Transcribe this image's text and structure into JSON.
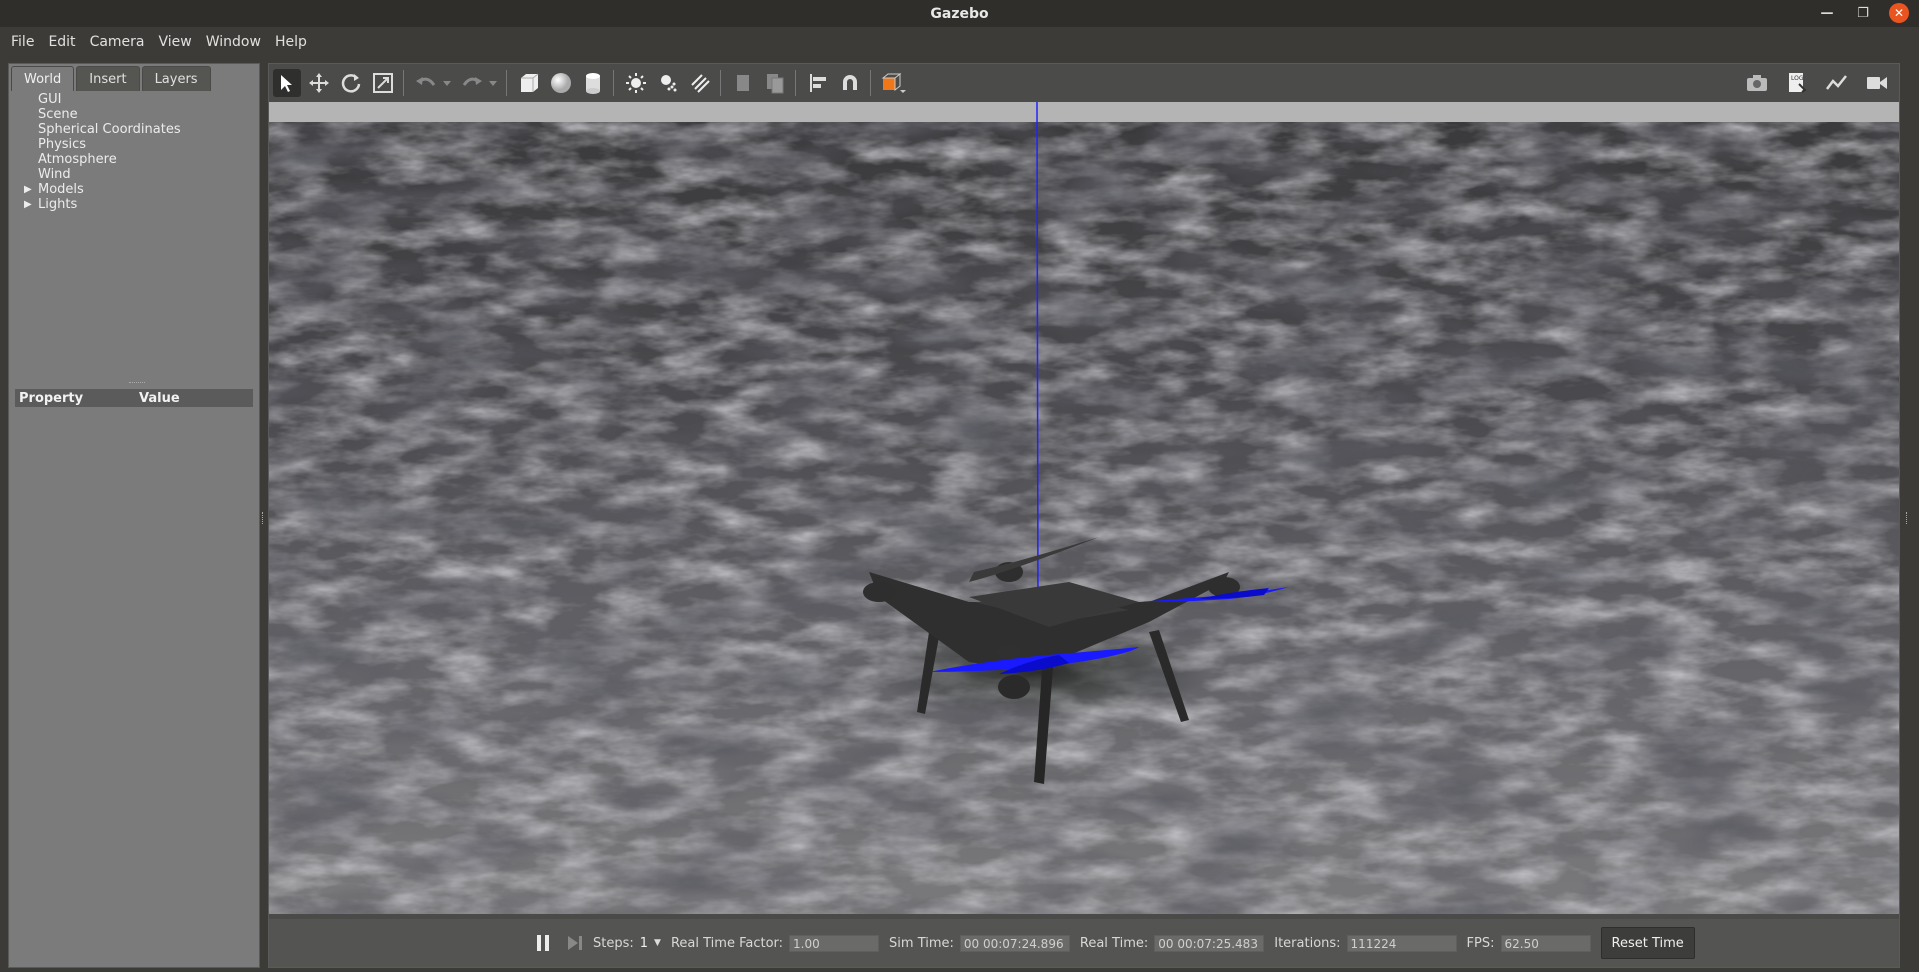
{
  "window": {
    "title": "Gazebo"
  },
  "menu": [
    "File",
    "Edit",
    "Camera",
    "View",
    "Window",
    "Help"
  ],
  "left_panel": {
    "tabs": [
      "World",
      "Insert",
      "Layers"
    ],
    "tree": [
      {
        "label": "GUI",
        "expandable": false
      },
      {
        "label": "Scene",
        "expandable": false
      },
      {
        "label": "Spherical Coordinates",
        "expandable": false
      },
      {
        "label": "Physics",
        "expandable": false
      },
      {
        "label": "Atmosphere",
        "expandable": false
      },
      {
        "label": "Wind",
        "expandable": false
      },
      {
        "label": "Models",
        "expandable": true
      },
      {
        "label": "Lights",
        "expandable": true
      }
    ],
    "properties": {
      "col_property": "Property",
      "col_value": "Value"
    }
  },
  "toolbar": {
    "icons": [
      "select-arrow-icon",
      "translate-icon",
      "rotate-icon",
      "scale-icon",
      "undo-icon",
      "undo-dropdown-icon",
      "redo-icon",
      "redo-dropdown-icon",
      "box-shape-icon",
      "sphere-shape-icon",
      "cylinder-shape-icon",
      "point-light-icon",
      "spot-light-icon",
      "directional-light-icon",
      "copy-icon",
      "paste-icon",
      "align-icon",
      "snap-magnet-icon",
      "view-angle-icon"
    ],
    "right_icons": [
      "screenshot-camera-icon",
      "log-icon",
      "plot-icon",
      "video-record-icon"
    ]
  },
  "bottom_bar": {
    "steps_label": "Steps:",
    "steps_value": "1",
    "rtf_label": "Real Time Factor:",
    "rtf_value": "1.00",
    "sim_time_label": "Sim Time:",
    "sim_time_value": "00 00:07:24.896",
    "real_time_label": "Real Time:",
    "real_time_value": "00 00:07:25.483",
    "iterations_label": "Iterations:",
    "iterations_value": "111224",
    "fps_label": "FPS:",
    "fps_value": "62.50",
    "reset_label": "Reset Time"
  },
  "colors": {
    "accent_close": "#e95420",
    "propeller": "#1a1aff",
    "z_axis": "#2222ff"
  }
}
